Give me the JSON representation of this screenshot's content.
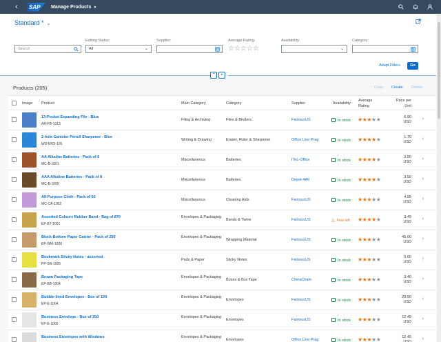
{
  "shell": {
    "logo": "SAP",
    "title": "Manage Products"
  },
  "header": {
    "variant": "Standard *",
    "filters": {
      "search_placeholder": "Search",
      "editing_status_label": "Editing Status:",
      "editing_status_value": "All",
      "supplier_label": "Supplier:",
      "rating_label": "Average Rating:",
      "availability_label": "Availability:",
      "category_label": "Category:"
    },
    "adapt_filters": "Adapt Filters",
    "go": "Go"
  },
  "table": {
    "title": "Products (205)",
    "actions": {
      "copy": "Copy",
      "create": "Create",
      "delete": "Delete"
    },
    "columns": {
      "image": "Image",
      "product": "Product",
      "main_category": "Main Category",
      "category": "Category",
      "supplier": "Supplier",
      "availability": "Availability",
      "rating_1": "Average",
      "rating_2": "Rating",
      "price_1": "Price per",
      "price_2": "Unit"
    },
    "rows": [
      {
        "name": "13-Pocket Expanding File - Blue",
        "id": "AR-FB-1013",
        "main": "Filing & Archiving",
        "category": "Files & Binders",
        "supplier": "FamousUS",
        "availability": "In stock",
        "status": "ok",
        "rating": 3,
        "price": "6.90",
        "currency": "USD",
        "thumb": "#4a7fc9"
      },
      {
        "name": "2-hole Canister Pencil Sharpener - Blue",
        "id": "WD-ERS-105",
        "main": "Writing & Drawing",
        "category": "Eraser, Ruler & Sharpener",
        "supplier": "Office Line Prag",
        "availability": "In stock",
        "status": "ok",
        "rating": 4,
        "price": "1.70",
        "currency": "USD",
        "thumb": "#2a86d9"
      },
      {
        "name": "AA Alkaline Batteries - Pack of 6",
        "id": "MC-B-1001",
        "main": "Miscellaneous",
        "category": "Batteries",
        "supplier": "ITeL-Office",
        "availability": "In stock",
        "status": "ok",
        "rating": 4,
        "price": "3.50",
        "currency": "USD",
        "thumb": "#a0522d"
      },
      {
        "name": "AAA Alkaline Batteries - Pack of 8",
        "id": "MC-B-1000",
        "main": "Miscellaneous",
        "category": "Batteries",
        "supplier": "Depot-4All",
        "availability": "In stock",
        "status": "ok",
        "rating": 4,
        "price": "3.50",
        "currency": "USD",
        "thumb": "#6b4a2a"
      },
      {
        "name": "All-Purpose Cloth - Pack of 50",
        "id": "MC-CA-1002",
        "main": "Miscellaneous",
        "category": "Cleaning Aids",
        "supplier": "FamousUS",
        "availability": "In stock",
        "status": "ok",
        "rating": 3,
        "price": "4.95",
        "currency": "USD",
        "thumb": "#c39ad8"
      },
      {
        "name": "Assorted Colours Rubber Band - Bag of 870",
        "id": "EP-BT-1001",
        "main": "Envelopes & Packaging",
        "category": "Bands & Twine",
        "supplier": "FamousUS",
        "availability": "Few left",
        "status": "warn",
        "rating": 4,
        "price": "3.49",
        "currency": "USD",
        "thumb": "#c7a34a"
      },
      {
        "name": "Block-Bottom Paper Carrier - Pack of 250",
        "id": "EP-WM-1000",
        "main": "Envelopes & Packaging",
        "category": "Wrapping Material",
        "supplier": "FamousUS",
        "availability": "In stock",
        "status": "ok",
        "rating": 3,
        "price": "45.00",
        "currency": "USD",
        "thumb": "#c89a6a"
      },
      {
        "name": "Bookmark Sticky Notes - assorted",
        "id": "PP-SN-1005",
        "main": "Pads & Paper",
        "category": "Sticky Notes",
        "supplier": "FamousUS",
        "availability": "In stock",
        "status": "ok",
        "rating": 3,
        "price": "5.60",
        "currency": "USD",
        "thumb": "#e6e040"
      },
      {
        "name": "Brown Packaging Tape",
        "id": "EP-BB-1004",
        "main": "Envelopes & Packaging",
        "category": "Boxes & Box Tape",
        "supplier": "ChinaChain",
        "availability": "In stock",
        "status": "ok",
        "rating": 3,
        "price": "3.40",
        "currency": "USD",
        "thumb": "#8b6a4a"
      },
      {
        "name": "Bubble-lined Envelopes - Box of 100",
        "id": "EP-E-1004",
        "main": "Envelopes & Packaging",
        "category": "Envelopes",
        "supplier": "FamousUS",
        "availability": "In stock",
        "status": "ok",
        "rating": 3,
        "price": "29.90",
        "currency": "USD",
        "thumb": "#d9b26a"
      },
      {
        "name": "Business Envelope - Box of 250",
        "id": "EP-E-1000",
        "main": "Envelopes & Packaging",
        "category": "Envelopes",
        "supplier": "FamousUS",
        "availability": "In stock",
        "status": "ok",
        "rating": 3,
        "price": "12.45",
        "currency": "USD",
        "thumb": "#e6e6e6"
      },
      {
        "name": "Business Envelopes with Windows",
        "id": "",
        "main": "Envelopes & Packaging",
        "category": "Envelopes",
        "supplier": "Office Line Prag",
        "availability": "In stock",
        "status": "ok",
        "rating": 3,
        "price": "12.45",
        "currency": "USD",
        "thumb": "#dcdcdc"
      }
    ]
  },
  "colors": {
    "shell": "#354a5f",
    "accent": "#0a6ed1",
    "success": "#107e3e",
    "warning": "#e9730c"
  }
}
